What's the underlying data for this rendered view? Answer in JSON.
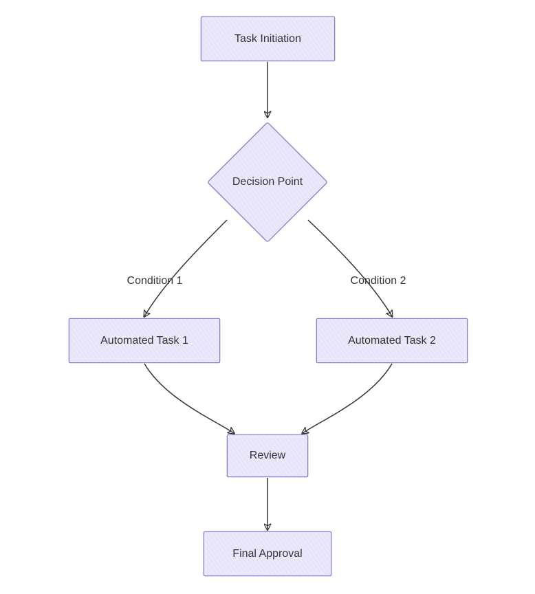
{
  "nodes": {
    "start": {
      "label": "Task Initiation"
    },
    "decision": {
      "label": "Decision Point"
    },
    "task1": {
      "label": "Automated Task 1"
    },
    "task2": {
      "label": "Automated Task 2"
    },
    "review": {
      "label": "Review"
    },
    "final": {
      "label": "Final Approval"
    }
  },
  "edges": {
    "cond1": {
      "label": "Condition 1"
    },
    "cond2": {
      "label": "Condition 2"
    }
  }
}
